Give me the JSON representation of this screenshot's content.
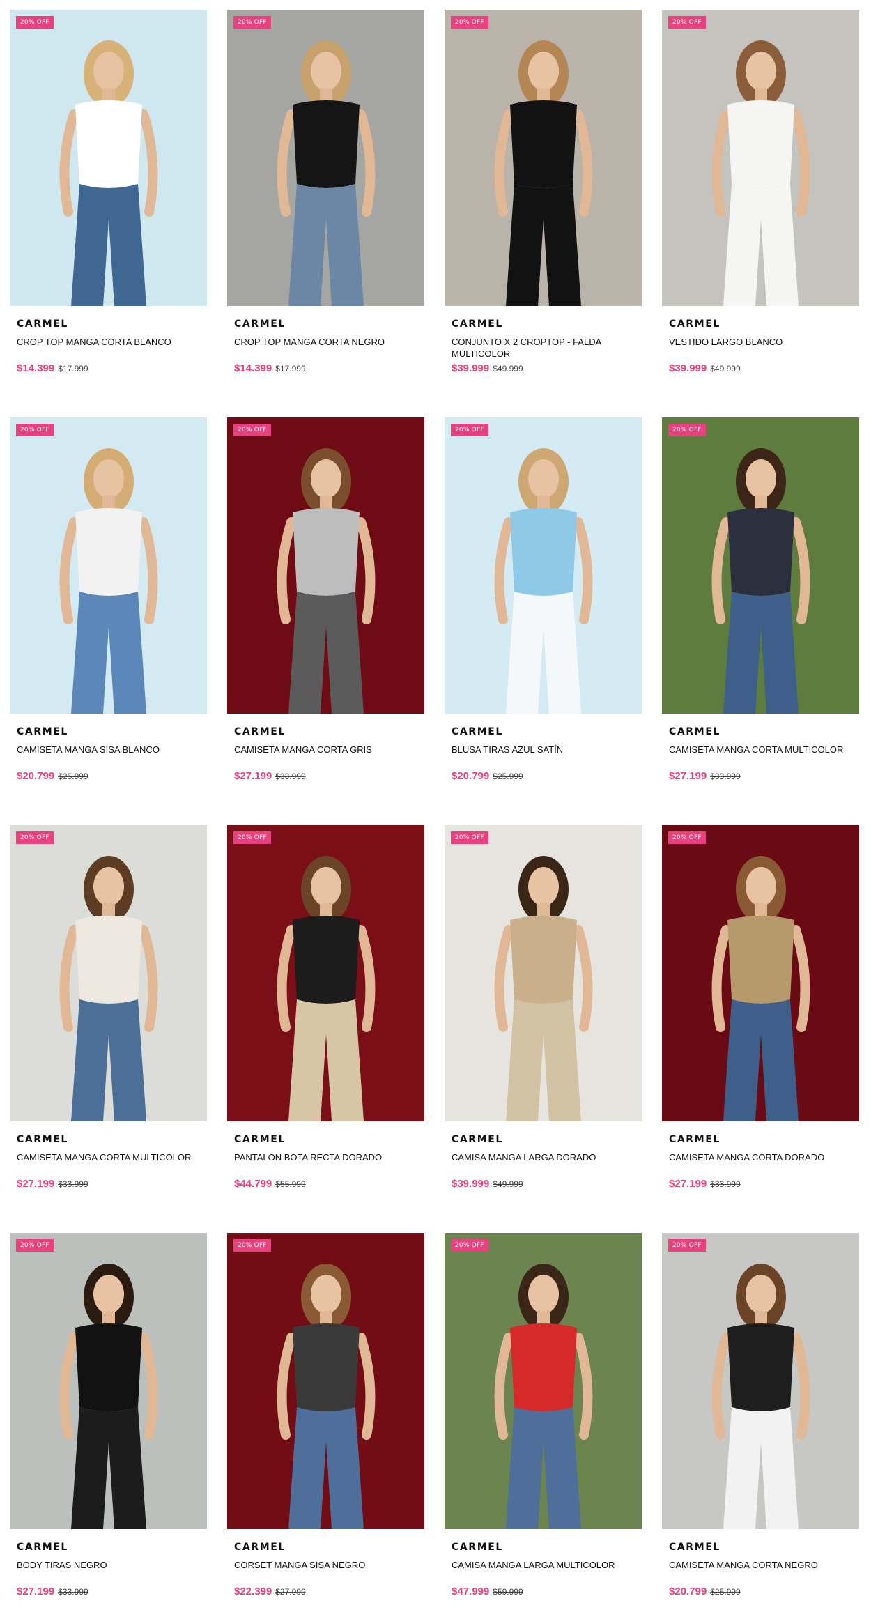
{
  "colors": {
    "accent": "#e8417f",
    "brand_text": "#111111",
    "old_price": "#444444"
  },
  "products": [
    {
      "brand": "CARMEL",
      "name": "CROP TOP MANGA CORTA BLANCO",
      "price": "$14.399",
      "old_price": "$17.999",
      "badge": "20% OFF",
      "bg": "#cfe8f0",
      "top": "#ffffff",
      "bottom": "#3f6791",
      "hair": "#d6b178"
    },
    {
      "brand": "CARMEL",
      "name": "CROP TOP MANGA CORTA NEGRO",
      "price": "$14.399",
      "old_price": "$17.999",
      "badge": "20% OFF",
      "bg": "#a5a5a1",
      "top": "#151515",
      "bottom": "#6c86a6",
      "hair": "#c7a26c"
    },
    {
      "brand": "CARMEL",
      "name": "CONJUNTO X 2 CROPTOP - FALDA MULTICOLOR",
      "price": "$39.999",
      "old_price": "$49.999",
      "badge": "20% OFF",
      "bg": "#b9b3a9",
      "top": "#121212",
      "bottom": "#121212",
      "hair": "#b48654"
    },
    {
      "brand": "CARMEL",
      "name": "VESTIDO LARGO BLANCO",
      "price": "$39.999",
      "old_price": "$49.999",
      "badge": "20% OFF",
      "bg": "#c4c3be",
      "top": "#f5f5f3",
      "bottom": "#f5f5f3",
      "hair": "#8a5e3a"
    },
    {
      "brand": "CARMEL",
      "name": "CAMISETA MANGA SISA BLANCO",
      "price": "$20.799",
      "old_price": "$25.999",
      "badge": "20% OFF",
      "bg": "#d3eaf2",
      "top": "#f2f2f2",
      "bottom": "#5b87b9",
      "hair": "#d4ad74"
    },
    {
      "brand": "CARMEL",
      "name": "CAMISETA MANGA CORTA GRIS",
      "price": "$27.199",
      "old_price": "$33.999",
      "badge": "20% OFF",
      "bg": "#6e0b14",
      "top": "#bdbdbd",
      "bottom": "#5b5b5b",
      "hair": "#7a4d2c"
    },
    {
      "brand": "CARMEL",
      "name": "BLUSA TIRAS AZUL SATÍN",
      "price": "$20.799",
      "old_price": "$25.999",
      "badge": "20% OFF",
      "bg": "#d5ebf4",
      "top": "#8ec9e8",
      "bottom": "#f5f8fa",
      "hair": "#cda873"
    },
    {
      "brand": "CARMEL",
      "name": "CAMISETA MANGA CORTA MULTICOLOR",
      "price": "$27.199",
      "old_price": "$33.999",
      "badge": "20% OFF",
      "bg": "#5f7c3f",
      "top": "#2b2f3e",
      "bottom": "#3e5f8a",
      "hair": "#3b2617"
    },
    {
      "brand": "CARMEL",
      "name": "CAMISETA MANGA CORTA MULTICOLOR",
      "price": "$27.199",
      "old_price": "$33.999",
      "badge": "20% OFF",
      "bg": "#dcdcd8",
      "top": "#ede8e0",
      "bottom": "#4c6f98",
      "hair": "#5d3c24"
    },
    {
      "brand": "CARMEL",
      "name": "PANTALON BOTA RECTA DORADO",
      "price": "$44.799",
      "old_price": "$55.999",
      "badge": "20% OFF",
      "bg": "#7a0f17",
      "top": "#1c1c1c",
      "bottom": "#d6c6a6",
      "hair": "#6b4428"
    },
    {
      "brand": "CARMEL",
      "name": "CAMISA MANGA LARGA DORADO",
      "price": "$39.999",
      "old_price": "$49.999",
      "badge": "20% OFF",
      "bg": "#e6e4df",
      "top": "#c9b08b",
      "bottom": "#d2c2a4",
      "hair": "#3a2616"
    },
    {
      "brand": "CARMEL",
      "name": "CAMISETA MANGA CORTA DORADO",
      "price": "$27.199",
      "old_price": "$33.999",
      "badge": "20% OFF",
      "bg": "#6a0a14",
      "top": "#b79a6c",
      "bottom": "#3e5f8a",
      "hair": "#8a5a34"
    },
    {
      "brand": "CARMEL",
      "name": "BODY TIRAS NEGRO",
      "price": "$27.199",
      "old_price": "$33.999",
      "badge": "20% OFF",
      "bg": "#bcc0bd",
      "top": "#121212",
      "bottom": "#1c1c1c",
      "hair": "#2a1a10"
    },
    {
      "brand": "CARMEL",
      "name": "CORSET MANGA SISA NEGRO",
      "price": "$22.399",
      "old_price": "$27.999",
      "badge": "20% OFF",
      "bg": "#720c15",
      "top": "#3a3a3a",
      "bottom": "#4d6f99",
      "hair": "#8a5a34"
    },
    {
      "brand": "CARMEL",
      "name": "CAMISA MANGA LARGA MULTICOLOR",
      "price": "$47.999",
      "old_price": "$59.999",
      "badge": "20% OFF",
      "bg": "#6c8450",
      "top": "#d62a2a",
      "bottom": "#4d6f99",
      "hair": "#3a2616"
    },
    {
      "brand": "CARMEL",
      "name": "CAMISETA MANGA CORTA NEGRO",
      "price": "$20.799",
      "old_price": "$25.999",
      "badge": "20% OFF",
      "bg": "#c7c8c3",
      "top": "#1e1e1e",
      "bottom": "#f2f2f2",
      "hair": "#6b4428"
    }
  ]
}
